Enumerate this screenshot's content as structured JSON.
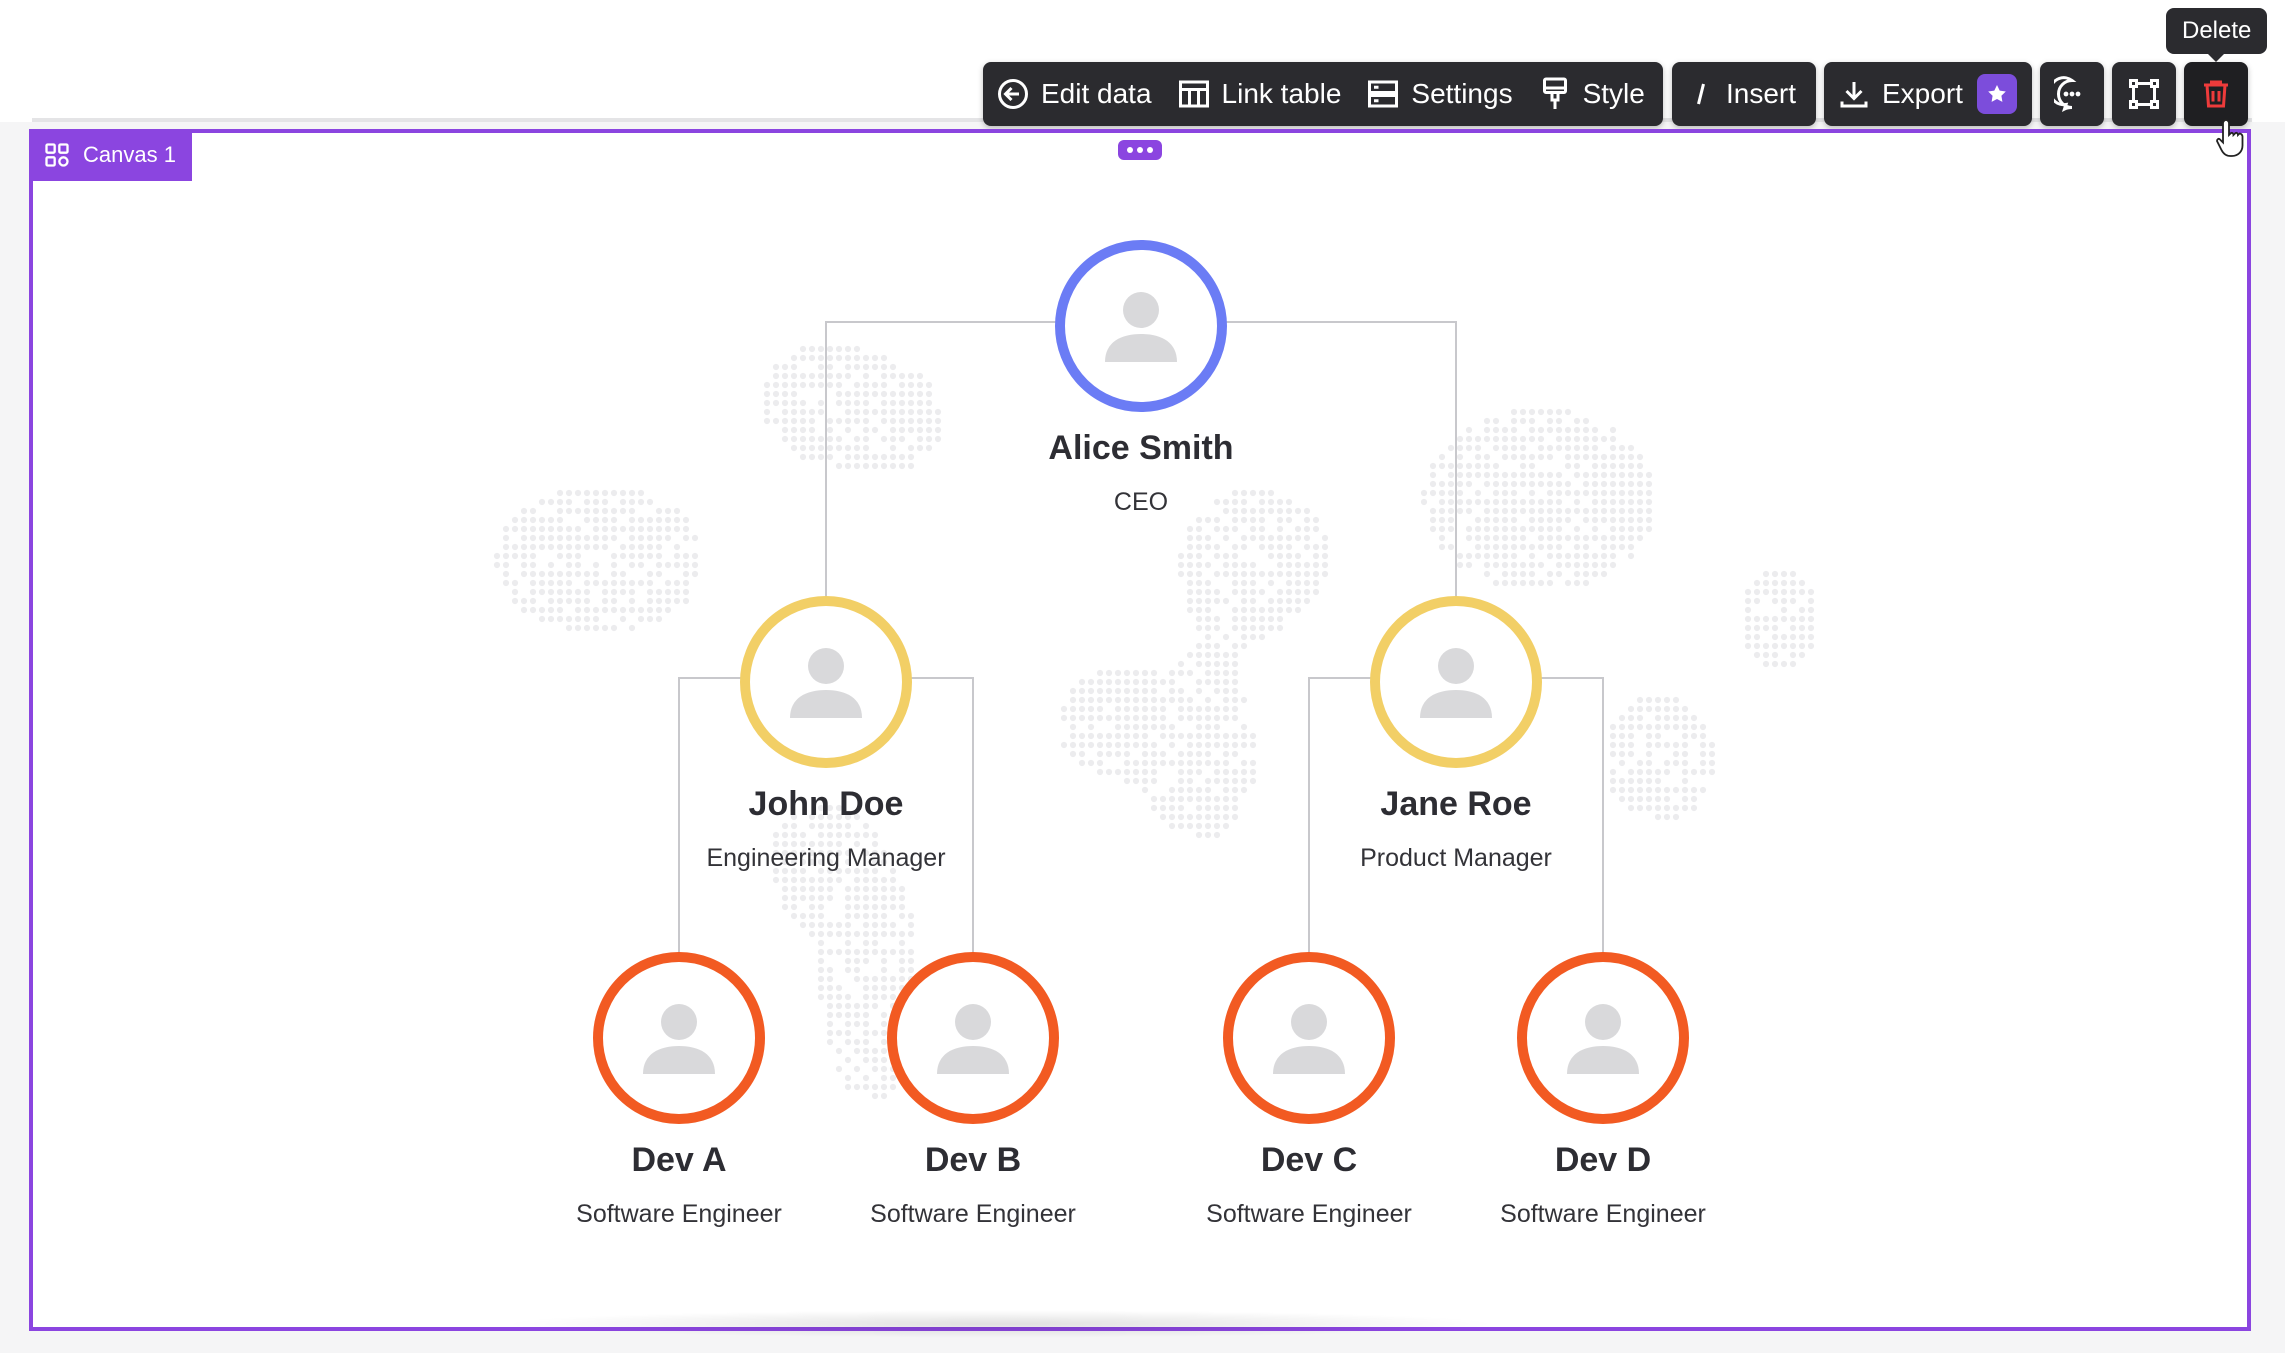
{
  "toolbar": {
    "edit_data": "Edit data",
    "link_table": "Link table",
    "settings": "Settings",
    "style": "Style",
    "insert": "Insert",
    "export": "Export",
    "tooltip": "Delete"
  },
  "canvas": {
    "label": "Canvas 1",
    "accent": "#8b45e0"
  },
  "org": {
    "ceo": {
      "name": "Alice Smith",
      "title": "CEO",
      "ring": "#6b7cf5"
    },
    "managers": [
      {
        "name": "John Doe",
        "title": "Engineering Manager",
        "ring": "#f2cf66"
      },
      {
        "name": "Jane Roe",
        "title": "Product Manager",
        "ring": "#f2cf66"
      }
    ],
    "engineers": [
      {
        "name": "Dev A",
        "title": "Software Engineer",
        "ring": "#f25a22"
      },
      {
        "name": "Dev B",
        "title": "Software Engineer",
        "ring": "#f25a22"
      },
      {
        "name": "Dev C",
        "title": "Software Engineer",
        "ring": "#f25a22"
      },
      {
        "name": "Dev D",
        "title": "Software Engineer",
        "ring": "#f25a22"
      }
    ]
  }
}
